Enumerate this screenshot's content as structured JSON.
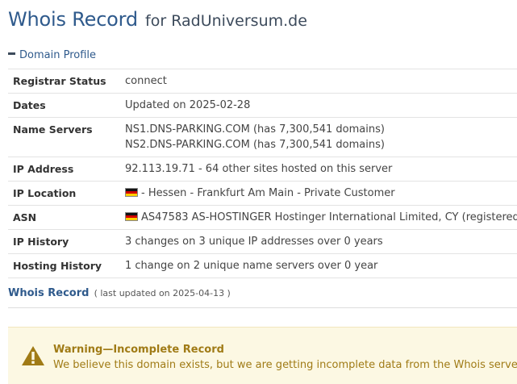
{
  "header": {
    "title_main": "Whois Record",
    "title_sub": "for RadUniversum.de"
  },
  "domain_profile": {
    "section_title": "Domain Profile",
    "rows": [
      {
        "label": "Registrar Status",
        "lines": [
          "connect"
        ]
      },
      {
        "label": "Dates",
        "lines": [
          "Updated on 2025-02-28"
        ]
      },
      {
        "label": "Name Servers",
        "lines": [
          "NS1.DNS-PARKING.COM (has 7,300,541 domains)",
          "NS2.DNS-PARKING.COM (has 7,300,541 domains)"
        ]
      },
      {
        "label": "IP Address",
        "lines": [
          "92.113.19.71 - 64 other sites hosted on this server"
        ]
      },
      {
        "label": "IP Location",
        "lines": [
          "- Hessen - Frankfurt Am Main - Private Customer"
        ],
        "flag": "germany-flag-icon"
      },
      {
        "label": "ASN",
        "lines": [
          "AS47583 AS-HOSTINGER Hostinger International Limited, CY (registered"
        ],
        "flag": "germany-flag-icon"
      },
      {
        "label": "IP History",
        "lines": [
          "3 changes on 3 unique IP addresses over 0 years"
        ]
      },
      {
        "label": "Hosting History",
        "lines": [
          "1 change on 2 unique name servers over 0 year"
        ]
      }
    ]
  },
  "whois_record": {
    "title": "Whois Record",
    "updated": "( last updated on 2025-04-13 )"
  },
  "warning": {
    "icon": "warning-triangle-icon",
    "title": "Warning—Incomplete Record",
    "message": "We believe this domain exists, but we are getting incomplete data from the Whois server."
  },
  "colors": {
    "title_blue": "#2f5a8c",
    "warning_bg": "#fcf8e3",
    "warning_text": "#a07b16"
  }
}
